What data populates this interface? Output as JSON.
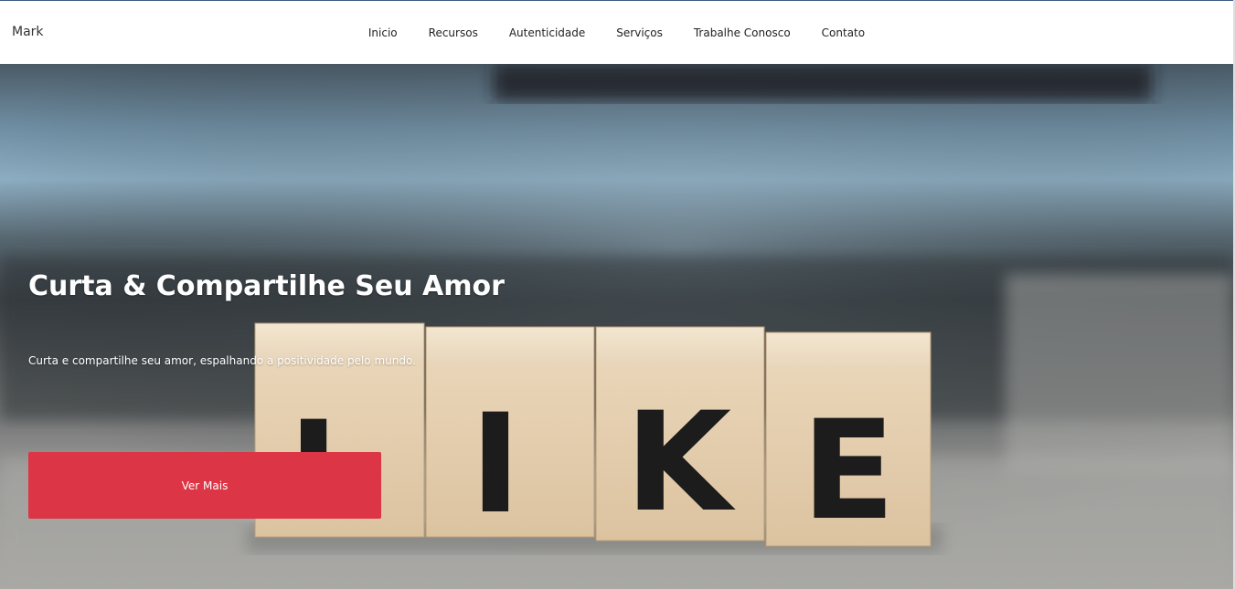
{
  "brand": {
    "name": "Mark"
  },
  "nav": {
    "items": [
      {
        "label": "Inicio"
      },
      {
        "label": "Recursos"
      },
      {
        "label": "Autenticidade"
      },
      {
        "label": "Serviços"
      },
      {
        "label": "Trabalhe Conosco"
      },
      {
        "label": "Contato"
      }
    ]
  },
  "hero": {
    "title": "Curta & Compartilhe Seu Amor",
    "subtitle": "Curta e compartilhe seu amor, espalhando a positividade pelo mundo.",
    "cta_label": "Ver Mais",
    "block_letters": [
      "L",
      "I",
      "K",
      "E"
    ]
  },
  "colors": {
    "cta": "#dc3545",
    "navbar_bg": "#ffffff",
    "hero_text": "#ffffff"
  }
}
